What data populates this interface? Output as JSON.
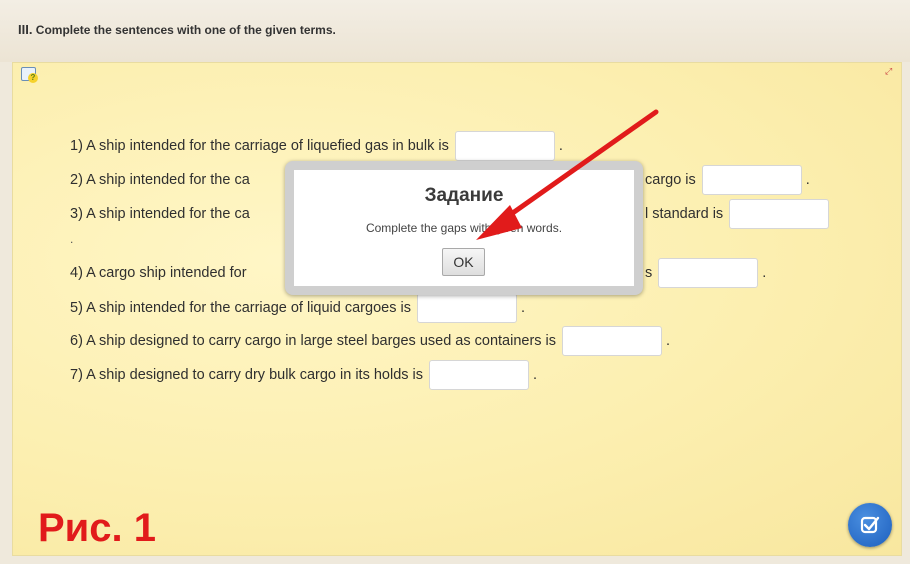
{
  "task": {
    "numeral": "III.",
    "instruction": "Complete the sentences with one of the given terms."
  },
  "sentences": [
    {
      "before": "1) A ship intended for the carriage of liquefied gas in bulk is",
      "after": "."
    },
    {
      "before": "2) A ship intended for the ca",
      "after": "cargo is",
      "tail": "."
    },
    {
      "before": "3) A ship intended for the ca",
      "after": "l standard is",
      "tail": ""
    },
    {
      "before": "4) A cargo ship intended for",
      "after": "s",
      "tail": "."
    },
    {
      "before": "5) A ship intended for the carriage of liquid cargoes is",
      "after": "."
    },
    {
      "before": "6) A ship designed to carry cargo in large steel barges used as containers is",
      "after": "."
    },
    {
      "before": "7) A ship designed to carry dry bulk cargo in its holds is",
      "after": "."
    }
  ],
  "stray_dot": ".",
  "dialog": {
    "title": "Задание",
    "message": "Complete the gaps with given words.",
    "ok_label": "OK"
  },
  "figure_label": "Рис. 1",
  "icons": {
    "hint": "hint-icon",
    "fullscreen": "fullscreen-icon",
    "check": "check-icon"
  },
  "colors": {
    "panel": "#fcefb0",
    "arrow": "#e11b1b",
    "check_button": "#2a6fcf"
  }
}
